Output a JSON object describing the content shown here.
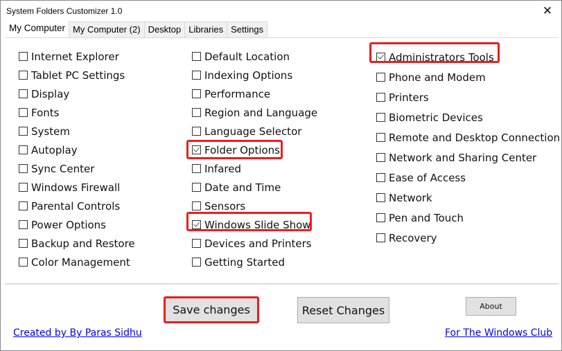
{
  "window": {
    "title": "System Folders Customizer 1.0",
    "close_glyph": "✕"
  },
  "tabs": [
    {
      "label": "My Computer",
      "active": true
    },
    {
      "label": "My Computer (2)",
      "active": false
    },
    {
      "label": "Desktop",
      "active": false
    },
    {
      "label": "Libraries",
      "active": false
    },
    {
      "label": "Settings",
      "active": false
    }
  ],
  "columns": [
    [
      {
        "label": "Internet Explorer",
        "checked": false
      },
      {
        "label": "Tablet PC Settings",
        "checked": false
      },
      {
        "label": "Display",
        "checked": false
      },
      {
        "label": "Fonts",
        "checked": false
      },
      {
        "label": "System",
        "checked": false
      },
      {
        "label": "Autoplay",
        "checked": false
      },
      {
        "label": "Sync Center",
        "checked": false
      },
      {
        "label": "Windows Firewall",
        "checked": false
      },
      {
        "label": "Parental Controls",
        "checked": false
      },
      {
        "label": "Power Options",
        "checked": false
      },
      {
        "label": "Backup and Restore",
        "checked": false
      },
      {
        "label": "Color Management",
        "checked": false
      }
    ],
    [
      {
        "label": "Default Location",
        "checked": false
      },
      {
        "label": "Indexing Options",
        "checked": false
      },
      {
        "label": "Performance",
        "checked": false
      },
      {
        "label": "Region and Language",
        "checked": false
      },
      {
        "label": "Language Selector",
        "checked": false
      },
      {
        "label": "Folder Options",
        "checked": true
      },
      {
        "label": "Infared",
        "checked": false
      },
      {
        "label": "Date and Time",
        "checked": false
      },
      {
        "label": "Sensors",
        "checked": false
      },
      {
        "label": "Windows Slide Show",
        "checked": true
      },
      {
        "label": "Devices and Printers",
        "checked": false
      },
      {
        "label": "Getting Started",
        "checked": false
      }
    ],
    [
      {
        "label": "Administrators Tools",
        "checked": true
      },
      {
        "label": "Phone and Modem",
        "checked": false
      },
      {
        "label": "Printers",
        "checked": false
      },
      {
        "label": "Biometric Devices",
        "checked": false
      },
      {
        "label": "Remote and Desktop Connection",
        "checked": false
      },
      {
        "label": "Network and Sharing Center",
        "checked": false
      },
      {
        "label": "Ease of Access",
        "checked": false
      },
      {
        "label": "Network",
        "checked": false
      },
      {
        "label": "Pen and Touch",
        "checked": false
      },
      {
        "label": "Recovery",
        "checked": false
      }
    ]
  ],
  "buttons": {
    "save": "Save changes",
    "reset": "Reset Changes",
    "about": "About"
  },
  "links": {
    "created_by": "Created by By Paras Sidhu",
    "for_club": "For The Windows Club"
  },
  "annotation_color": "#ee1c1c"
}
